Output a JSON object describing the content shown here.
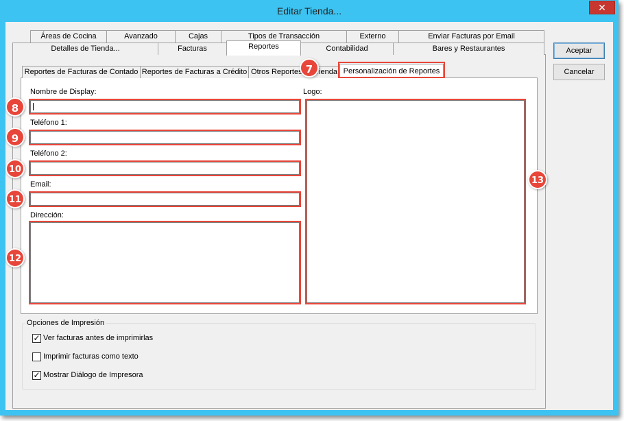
{
  "window": {
    "title": "Editar Tienda...",
    "close_glyph": "✕"
  },
  "tabs_row1": [
    {
      "label": "Áreas de Cocina"
    },
    {
      "label": "Avanzado"
    },
    {
      "label": "Cajas"
    },
    {
      "label": "Tipos de Transacción"
    },
    {
      "label": "Externo"
    },
    {
      "label": "Enviar Facturas por Email"
    }
  ],
  "tabs_row2": [
    {
      "label": "Detalles de Tienda..."
    },
    {
      "label": "Facturas"
    },
    {
      "label": "Reportes"
    },
    {
      "label": "Contabilidad"
    },
    {
      "label": "Bares y Restaurantes"
    }
  ],
  "subtabs": [
    {
      "label": "Reportes de Facturas de Contado"
    },
    {
      "label": "Reportes de Facturas a Crédito"
    },
    {
      "label": "Otros Reportes de Tienda"
    },
    {
      "label": "Personalización de Reportes"
    }
  ],
  "buttons": {
    "accept": "Aceptar",
    "cancel": "Cancelar"
  },
  "form": {
    "display_name_label": "Nombre de Display:",
    "display_name_value": "",
    "phone1_label": "Teléfono 1:",
    "phone1_value": "",
    "phone2_label": "Teléfono 2:",
    "phone2_value": "",
    "email_label": "Email:",
    "email_value": "",
    "address_label": "Dirección:",
    "address_value": "",
    "logo_label": "Logo:"
  },
  "print_options": {
    "legend": "Opciones de Impresión",
    "items": [
      {
        "label": "Ver facturas antes de imprimirlas",
        "checked": true
      },
      {
        "label": "Imprimir facturas como texto",
        "checked": false
      },
      {
        "label": "Mostrar Diálogo de Impresora",
        "checked": true
      }
    ]
  },
  "callouts": [
    "7",
    "8",
    "9",
    "10",
    "11",
    "12",
    "13"
  ],
  "colors": {
    "title_bar": "#3cc3f1",
    "close_button": "#c7372f",
    "callout": "#e8463a"
  },
  "icons": {
    "close": "close-icon",
    "check": "checkmark-icon"
  }
}
